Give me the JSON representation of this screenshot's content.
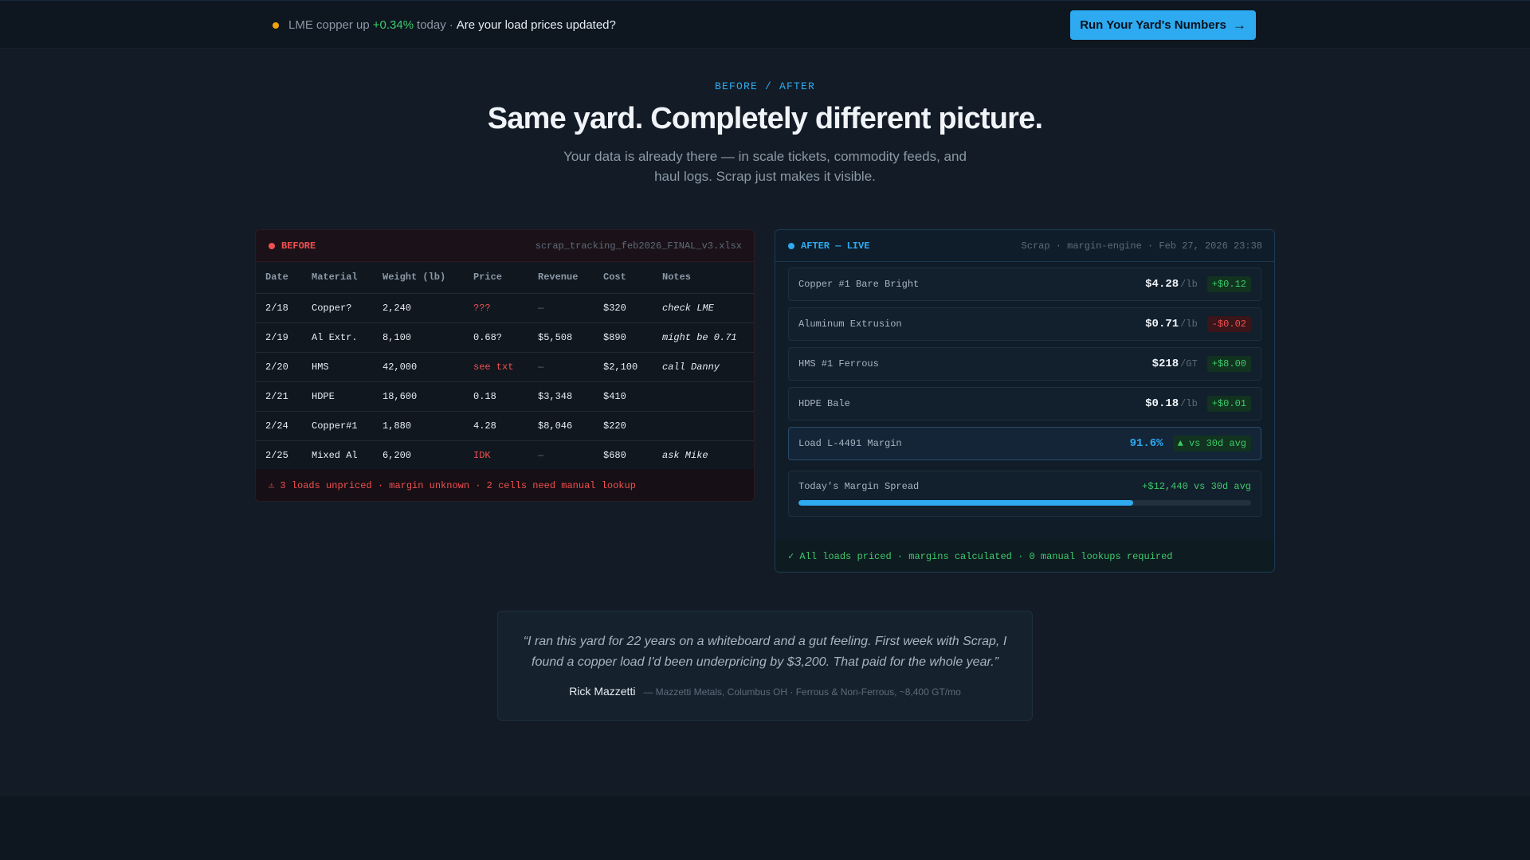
{
  "topbar": {
    "ticker_prefix": "LME copper up",
    "ticker_change": "+0.34%",
    "ticker_suffix": "today",
    "ticker_separator": "·",
    "ticker_question": "Are your load prices updated?",
    "cta_label": "Run Your Yard's Numbers",
    "cta_icon": "arrow-right-icon",
    "status_dot_color": "#f0a30a"
  },
  "hero": {
    "kicker": "BEFORE / AFTER",
    "title": "Same yard. Completely different picture.",
    "subtitle": "Your data is already there — in scale tickets, commodity feeds, and haul logs. Scrap just makes it visible."
  },
  "before": {
    "tag": "BEFORE",
    "filename": "scrap_tracking_feb2026_FINAL_v3.xlsx",
    "columns": [
      "Date",
      "Material",
      "Weight (lb)",
      "Price",
      "Revenue",
      "Cost",
      "Notes"
    ],
    "rows": [
      [
        "2/18",
        "Copper?",
        "2,240",
        "???",
        "—",
        "$320",
        "check LME"
      ],
      [
        "2/19",
        "Al Extr.",
        "8,100",
        "0.68?",
        "$5,508",
        "$890",
        "might be 0.71"
      ],
      [
        "2/20",
        "HMS",
        "42,000",
        "see txt",
        "—",
        "$2,100",
        "call Danny"
      ],
      [
        "2/21",
        "HDPE",
        "18,600",
        "0.18",
        "$3,348",
        "$410",
        ""
      ],
      [
        "2/24",
        "Copper#1",
        "1,880",
        "4.28",
        "$8,046",
        "$220",
        ""
      ],
      [
        "2/25",
        "Mixed Al",
        "6,200",
        "IDK",
        "—",
        "$680",
        "ask Mike"
      ]
    ],
    "footer": "⚠ 3 loads unpriced · margin unknown · 2 cells need manual lookup"
  },
  "after": {
    "tag": "AFTER — LIVE",
    "meta": "Scrap · margin-engine · Feb 27, 2026 23:38",
    "materials": [
      {
        "name": "Copper #1 Bare Bright",
        "price": "$4.28",
        "unit": "/lb",
        "delta": "+$0.12",
        "direction": "up"
      },
      {
        "name": "Aluminum Extrusion",
        "price": "$0.71",
        "unit": "/lb",
        "delta": "-$0.02",
        "direction": "down"
      },
      {
        "name": "HMS #1 Ferrous",
        "price": "$218",
        "unit": "/GT",
        "delta": "+$8.00",
        "direction": "up"
      },
      {
        "name": "HDPE Bale",
        "price": "$0.18",
        "unit": "/lb",
        "delta": "+$0.01",
        "direction": "up"
      }
    ],
    "margin": {
      "label": "Load L-4491 Margin",
      "value": "91.6%",
      "badge": "▲ vs 30d avg"
    },
    "spread": {
      "label": "Today's Margin Spread",
      "value": "+$12,440 vs 30d avg",
      "progress": 0.74
    },
    "footer": "✓ All loads priced · margins calculated · 0 manual lookups required"
  },
  "testimonial": {
    "quote": "“I ran this yard for 22 years on a whiteboard and a gut feeling. First week with Scrap, I found a copper load I'd been underpricing by $3,200. That paid for the whole year.”",
    "author": "Rick Mazzetti",
    "company": "— Mazzetti Metals, Columbus OH · Ferrous & Non-Ferrous, ~8,400 GT/mo"
  },
  "colors": {
    "accent": "#2eaaf0",
    "positive": "#3fca6b",
    "negative": "#f05050",
    "background": "#131c26"
  }
}
